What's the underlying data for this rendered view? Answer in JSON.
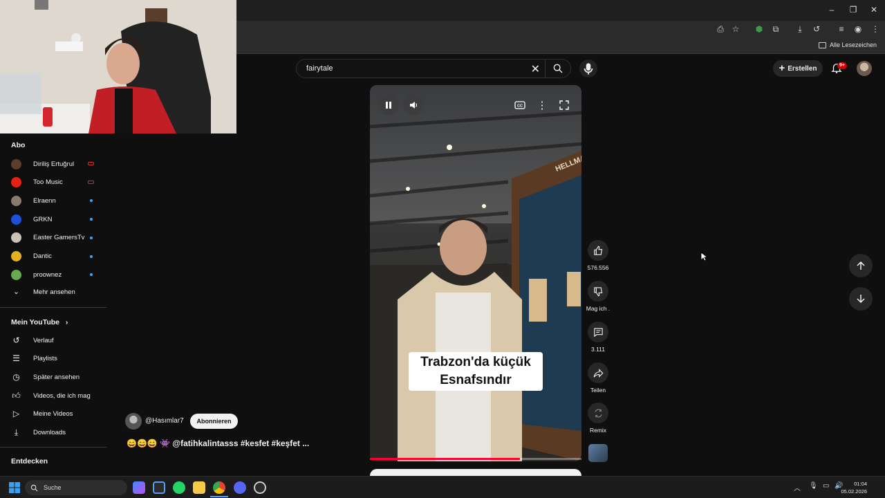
{
  "search": {
    "query": "fairytale"
  },
  "header": {
    "create_label": "Erstellen",
    "notification_count": "9+"
  },
  "bookmarks": {
    "all_label": "Alle Lesezeichen"
  },
  "sidebar": {
    "section_partial": "Abo",
    "subscriptions": [
      {
        "name": "Diriliş Ertuğrul",
        "status": "live",
        "color": "#5a3d2b"
      },
      {
        "name": "Too Music",
        "status": "live",
        "color": "#e62117"
      },
      {
        "name": "Elraenn",
        "status": "new",
        "color": "#8a7a6c"
      },
      {
        "name": "GRKN",
        "status": "new",
        "color": "#1f4fd6"
      },
      {
        "name": "Easter GamersTv",
        "status": "new",
        "color": "#c9c2b5"
      },
      {
        "name": "Dantic",
        "status": "new",
        "color": "#e5b21f"
      },
      {
        "name": "proownez",
        "status": "new",
        "color": "#6aa84f"
      }
    ],
    "show_more": "Mehr ansehen",
    "my_youtube": "Mein YouTube",
    "my_items": [
      {
        "label": "Verlauf",
        "icon": "history-icon"
      },
      {
        "label": "Playlists",
        "icon": "playlists-icon"
      },
      {
        "label": "Später ansehen",
        "icon": "watch-later-icon"
      },
      {
        "label": "Videos, die ich mag",
        "icon": "like-icon"
      },
      {
        "label": "Meine Videos",
        "icon": "my-videos-icon"
      },
      {
        "label": "Downloads",
        "icon": "download-icon"
      }
    ],
    "explore": "Entdecken"
  },
  "video": {
    "caption_line1": "Trabzon'da küçük",
    "caption_line2": "Esnafsındır",
    "progress": 0.71,
    "channel": "@Hasımlar7",
    "subscribe_label": "Abonnieren",
    "description": "😄😄😄 👾 @fatihkalintasss #kesfet #keşfet ...",
    "board_text": "HELLMAN"
  },
  "actions": {
    "likes": "576.556",
    "dislike_label": "Mag ich .",
    "comments": "3.111",
    "share_label": "Teilen",
    "remix_label": "Remix"
  },
  "taskbar": {
    "search_placeholder": "Suche",
    "time": "01:04",
    "date": "05.02.2026"
  },
  "colors": {
    "accent_red": "#ff0033",
    "background": "#0f0f0f",
    "live": "#e02828",
    "new_dot": "#3ea6ff"
  }
}
